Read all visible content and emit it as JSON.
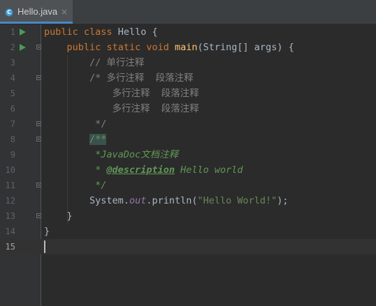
{
  "tab": {
    "icon_letter": "C",
    "title": "Hello.java",
    "close": "×"
  },
  "gutter": {
    "lines": [
      "1",
      "2",
      "3",
      "4",
      "5",
      "6",
      "7",
      "8",
      "9",
      "10",
      "11",
      "12",
      "13",
      "14",
      "15"
    ],
    "current_line": "15"
  },
  "code": {
    "l1": {
      "t1": "public",
      "t2": " ",
      "t3": "class",
      "t4": " Hello {"
    },
    "l2": {
      "indent": "    ",
      "t1": "public",
      "t2": " ",
      "t3": "static",
      "t4": " ",
      "t5": "void",
      "t6": " ",
      "t7": "main",
      "t8": "(String[] args) {"
    },
    "l3": {
      "indent": "        ",
      "t1": "// 单行注释"
    },
    "l4": {
      "indent": "        ",
      "t1": "/* 多行注释  段落注释"
    },
    "l5": {
      "indent": "            ",
      "t1": "多行注释  段落注释"
    },
    "l6": {
      "indent": "            ",
      "t1": "多行注释  段落注释"
    },
    "l7": {
      "indent": "         ",
      "t1": "*/"
    },
    "l8": {
      "indent": "        ",
      "t1": "/**"
    },
    "l9": {
      "indent": "         ",
      "t1": "*JavaDoc文档注释"
    },
    "l10": {
      "indent": "         ",
      "t1": "* ",
      "t2": "@description",
      "t3": " Hello world"
    },
    "l11": {
      "indent": "         ",
      "t1": "*/"
    },
    "l12": {
      "indent": "        ",
      "t1": "System.",
      "t2": "out",
      "t3": ".println(",
      "t4": "\"Hello World!\"",
      "t5": ");"
    },
    "l13": {
      "indent": "    ",
      "t1": "}"
    },
    "l14": {
      "indent": "",
      "t1": "}"
    }
  },
  "colors": {
    "background": "#2b2b2b",
    "gutter": "#313335",
    "keyword": "#cc7832",
    "method": "#ffc66d",
    "comment": "#808080",
    "doc_comment": "#629755",
    "string": "#6a8759",
    "static_field": "#9876aa",
    "run_icon": "#499c54"
  }
}
